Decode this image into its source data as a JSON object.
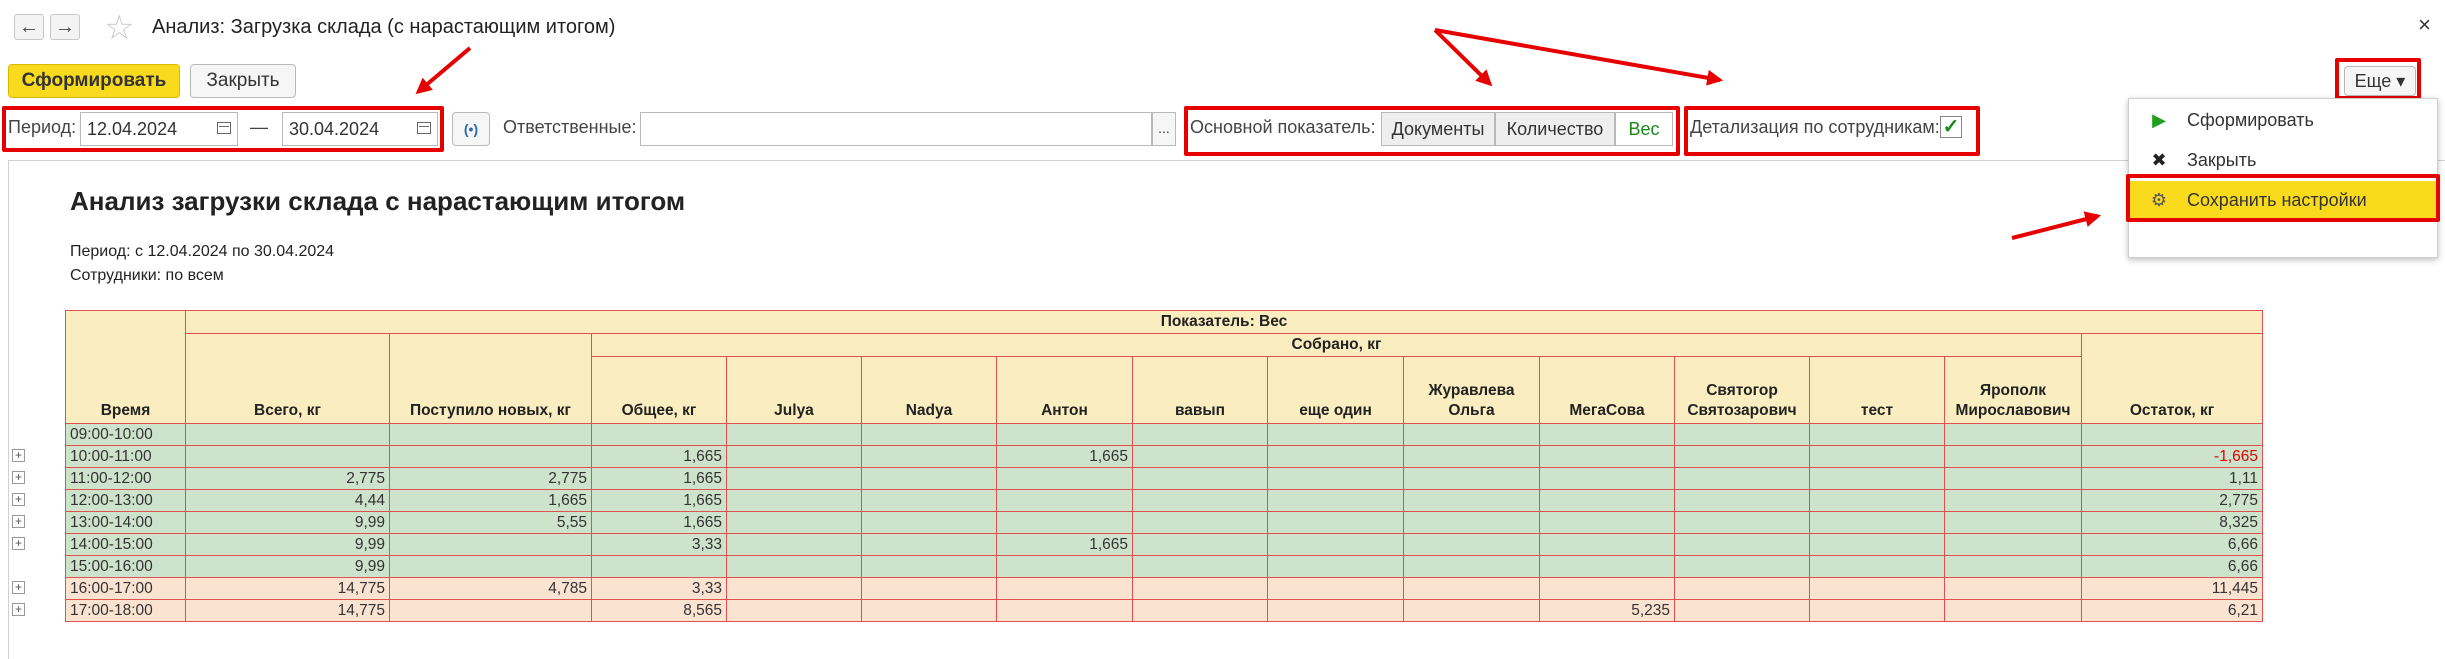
{
  "window": {
    "title": "Анализ: Загрузка склада (с нарастающим итогом)",
    "close": "×",
    "back": "←",
    "forward": "→",
    "star": "☆"
  },
  "toolbar": {
    "generate_label": "Сформировать",
    "close_label": "Закрыть",
    "more_label": "Еще ▾"
  },
  "filters": {
    "period_label": "Период:",
    "date_from": "12.04.2024",
    "dash": "—",
    "date_to": "30.04.2024",
    "link_glyph": "(•)",
    "responsible_label": "Ответственные:",
    "responsible_value": "",
    "select_glyph": "...",
    "indicator_label": "Основной показатель:",
    "indicator_options": [
      "Документы",
      "Количество",
      "Вес"
    ],
    "indicator_selected": "Вес",
    "detail_label": "Детализация по сотрудникам:",
    "detail_checked": "✓"
  },
  "report": {
    "title": "Анализ загрузки склада с нарастающим итогом",
    "period_line": "Период: с 12.04.2024 по 30.04.2024",
    "staff_line": "Сотрудники: по всем",
    "header": {
      "indicator": "Показатель: Вес",
      "collected": "Собрано, кг",
      "time": "Время",
      "total": "Всего, кг",
      "received": "Поступило новых, кг",
      "general": "Общее, кг",
      "employees": [
        "Julya",
        "Nadya",
        "Антон",
        "вавып",
        "еще один",
        "Журавлева Ольга",
        "МегаСова",
        "Святогор Святозарович",
        "тест",
        "Ярополк Мирославович"
      ],
      "balance": "Остаток, кг"
    },
    "rows": [
      {
        "time": "09:00-10:00",
        "total": "",
        "received": "",
        "general": "",
        "cols": [
          "",
          "",
          "",
          "",
          "",
          "",
          "",
          "",
          "",
          ""
        ],
        "balance": "",
        "style": "g",
        "expand": false
      },
      {
        "time": "10:00-11:00",
        "total": "",
        "received": "",
        "general": "1,665",
        "cols": [
          "",
          "",
          "1,665",
          "",
          "",
          "",
          "",
          "",
          "",
          ""
        ],
        "balance": "-1,665",
        "style": "g",
        "expand": true
      },
      {
        "time": "11:00-12:00",
        "total": "2,775",
        "received": "2,775",
        "general": "1,665",
        "cols": [
          "",
          "",
          "",
          "",
          "",
          "",
          "",
          "",
          "",
          ""
        ],
        "balance": "1,11",
        "style": "g",
        "expand": true
      },
      {
        "time": "12:00-13:00",
        "total": "4,44",
        "received": "1,665",
        "general": "1,665",
        "cols": [
          "",
          "",
          "",
          "",
          "",
          "",
          "",
          "",
          "",
          ""
        ],
        "balance": "2,775",
        "style": "g",
        "expand": true
      },
      {
        "time": "13:00-14:00",
        "total": "9,99",
        "received": "5,55",
        "general": "1,665",
        "cols": [
          "",
          "",
          "",
          "",
          "",
          "",
          "",
          "",
          "",
          ""
        ],
        "balance": "8,325",
        "style": "g",
        "expand": true
      },
      {
        "time": "14:00-15:00",
        "total": "9,99",
        "received": "",
        "general": "3,33",
        "cols": [
          "",
          "",
          "1,665",
          "",
          "",
          "",
          "",
          "",
          "",
          ""
        ],
        "balance": "6,66",
        "style": "g",
        "expand": true
      },
      {
        "time": "15:00-16:00",
        "total": "9,99",
        "received": "",
        "general": "",
        "cols": [
          "",
          "",
          "",
          "",
          "",
          "",
          "",
          "",
          "",
          ""
        ],
        "balance": "6,66",
        "style": "g",
        "expand": false
      },
      {
        "time": "16:00-17:00",
        "total": "14,775",
        "received": "4,785",
        "general": "3,33",
        "cols": [
          "",
          "",
          "",
          "",
          "",
          "",
          "",
          "",
          "",
          ""
        ],
        "balance": "11,445",
        "style": "p",
        "expand": true
      },
      {
        "time": "17:00-18:00",
        "total": "14,775",
        "received": "",
        "general": "8,565",
        "cols": [
          "",
          "",
          "",
          "",
          "",
          "",
          "5,235",
          "",
          "",
          ""
        ],
        "balance": "6,21",
        "style": "p",
        "expand": true
      }
    ]
  },
  "more_menu": {
    "items": [
      {
        "label": "Сформировать",
        "icon": "play-icon",
        "glyph": "▶"
      },
      {
        "label": "Закрыть",
        "icon": "close-icon",
        "glyph": "✖"
      },
      {
        "label": "Сохранить настройки",
        "icon": "settings-icon",
        "glyph": "⚙"
      }
    ],
    "selected": "Сохранить настройки"
  },
  "colors": {
    "accent_yellow": "#f9da1c",
    "annotation_red": "#e60000",
    "header_fill": "#faeec0",
    "row_green": "#cde3cc",
    "row_pink": "#fbe3d2",
    "negative": "#e00000"
  }
}
